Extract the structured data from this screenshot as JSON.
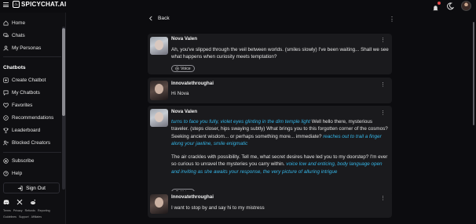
{
  "app": {
    "logo_text": "SPICYCHAT.AI"
  },
  "sidebar": {
    "items": [
      {
        "label": "Home",
        "icon": "home-icon"
      },
      {
        "label": "Chats",
        "icon": "chat-bubbles-icon"
      },
      {
        "label": "My Personas",
        "icon": "person-icon"
      }
    ],
    "section_title": "Chatbots",
    "chatbot_items": [
      {
        "label": "Create Chatbot",
        "icon": "plus-square-icon"
      },
      {
        "label": "My Chatbots",
        "icon": "chat-icon"
      },
      {
        "label": "Favorites",
        "icon": "heart-icon"
      },
      {
        "label": "Recommendations",
        "icon": "compass-icon"
      },
      {
        "label": "Leaderboard",
        "icon": "trophy-icon"
      },
      {
        "label": "Blocked Creators",
        "icon": "user-block-icon"
      }
    ],
    "bottom_items": [
      {
        "label": "Subscribe",
        "icon": "star-badge-icon"
      },
      {
        "label": "Help",
        "icon": "help-circle-icon"
      }
    ],
    "sign_out_label": "Sign Out",
    "footer_links_row1": [
      "Terms",
      "Privacy",
      "Refunds",
      "Reporting"
    ],
    "footer_links_row2": [
      "Guidelines",
      "Support",
      "Affiliates"
    ]
  },
  "chat": {
    "back_label": "Back",
    "voice_label": "Voice",
    "messages": [
      {
        "author": "Nova Valen",
        "role": "bot",
        "text": "Ah, you've slipped through the veil between worlds. (smiles slowly) I've been waiting... Shall we see what happens when curiosity meets temptation?"
      },
      {
        "author": "Innovatethroughai",
        "role": "user",
        "text": "Hi Nova"
      },
      {
        "author": "Nova Valen",
        "role": "bot",
        "p1_act1": "turns to face you fully, violet eyes glinting in the dim temple light",
        "p1_text1": " Well hello there, mysterious traveler. (steps closer, hips swaying subtly) What brings you to this forgotten corner of the cosmos? Seeking ancient wisdom... or perhaps something more... immediate? ",
        "p1_act2": "reaches out to trail a finger along your jawline, smile enigmatic",
        "p2_text1": "The air crackles with possibility. Tell me, what secret desires have led you to my doorstep? I'm ever so curious to unravel the mysteries you carry within. ",
        "p2_act1": "voice low and enticing, body language open and inviting as she awaits your response, the very picture of alluring intrigue"
      },
      {
        "author": "Innovatethroughai",
        "role": "user",
        "text": "I want to stop by and say hi to my mistress"
      }
    ]
  },
  "colors": {
    "background": "#0c0c0f",
    "card": "#1a1a1d",
    "action_text": "#35b6e8",
    "notification": "#e54848"
  }
}
